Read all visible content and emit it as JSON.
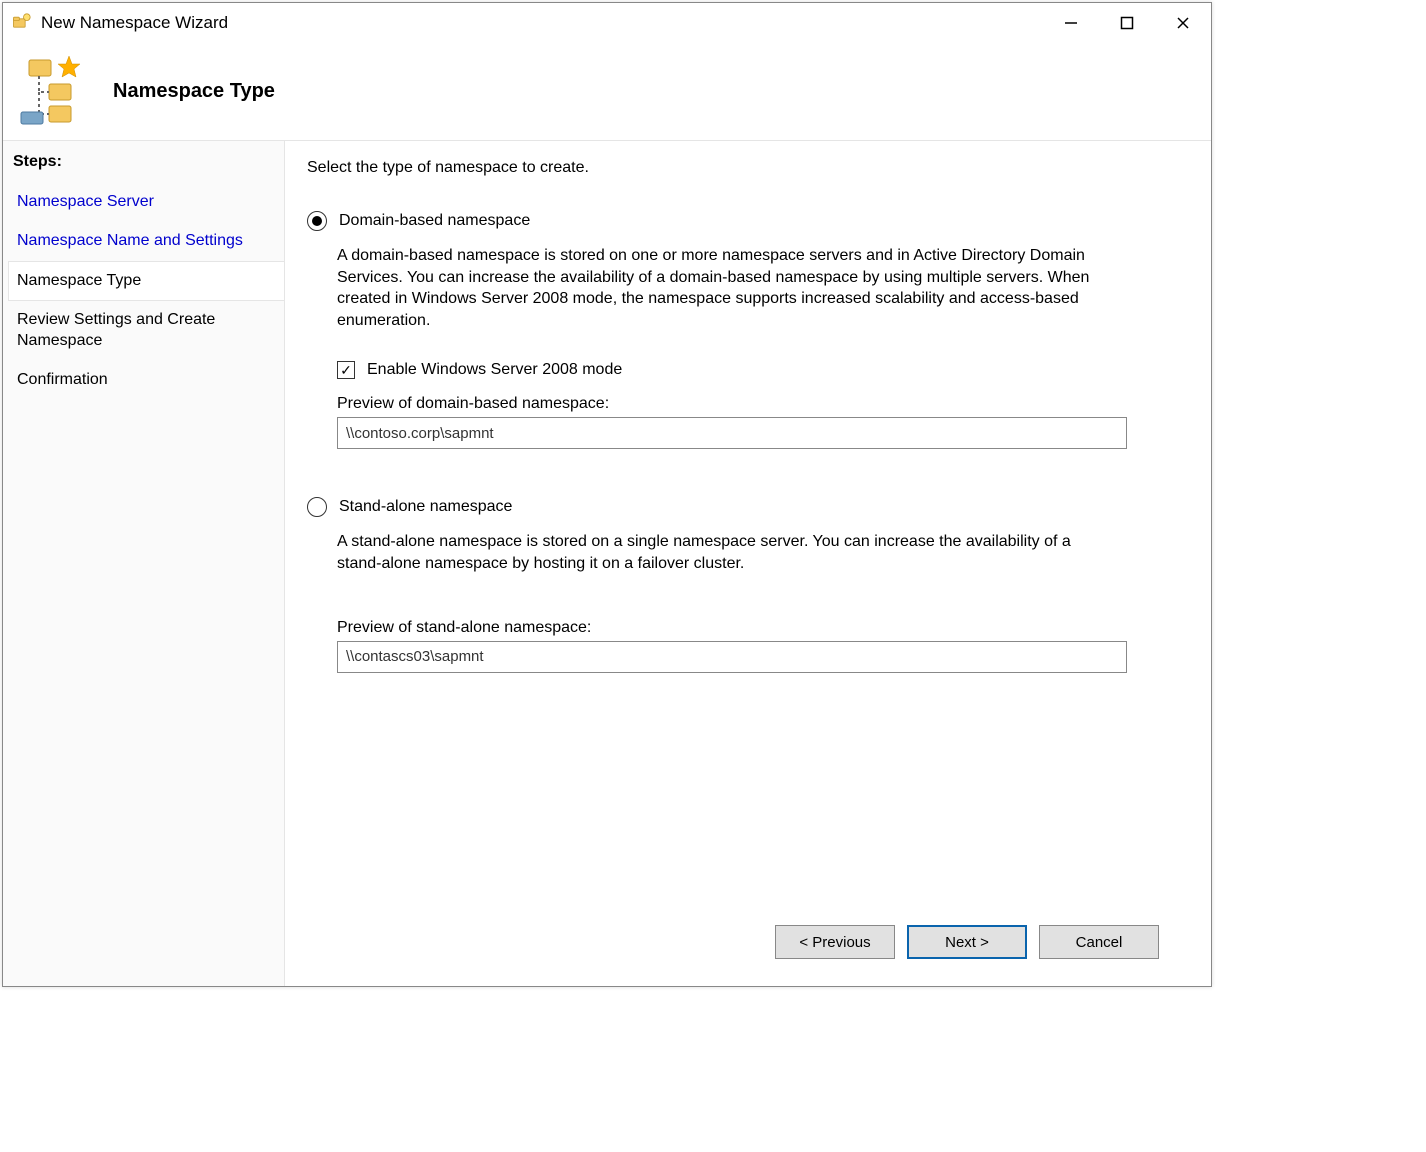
{
  "window": {
    "title": "New Namespace Wizard"
  },
  "header": {
    "title": "Namespace Type"
  },
  "sidebar": {
    "header": "Steps:",
    "items": [
      {
        "label": "Namespace Server",
        "state": "link"
      },
      {
        "label": "Namespace Name and Settings",
        "state": "link"
      },
      {
        "label": "Namespace Type",
        "state": "current"
      },
      {
        "label": "Review Settings and Create Namespace",
        "state": "upcoming"
      },
      {
        "label": "Confirmation",
        "state": "upcoming"
      }
    ]
  },
  "content": {
    "instruction": "Select the type of namespace to create.",
    "option_domain": {
      "label": "Domain-based namespace",
      "selected": true,
      "description": "A domain-based namespace is stored on one or more namespace servers and in Active Directory Domain Services. You can increase the availability of a domain-based namespace by using multiple servers. When created in Windows Server 2008 mode, the namespace supports increased scalability and access-based enumeration.",
      "checkbox_label": "Enable Windows Server 2008 mode",
      "checkbox_checked": true,
      "preview_label": "Preview of domain-based namespace:",
      "preview_value": "\\\\contoso.corp\\sapmnt"
    },
    "option_standalone": {
      "label": "Stand-alone namespace",
      "selected": false,
      "description": "A stand-alone namespace is stored on a single namespace server. You can increase the availability of a stand-alone namespace by hosting it on a failover cluster.",
      "preview_label": "Preview of stand-alone namespace:",
      "preview_value": "\\\\contascs03\\sapmnt"
    }
  },
  "footer": {
    "previous": "< Previous",
    "next": "Next >",
    "cancel": "Cancel"
  }
}
